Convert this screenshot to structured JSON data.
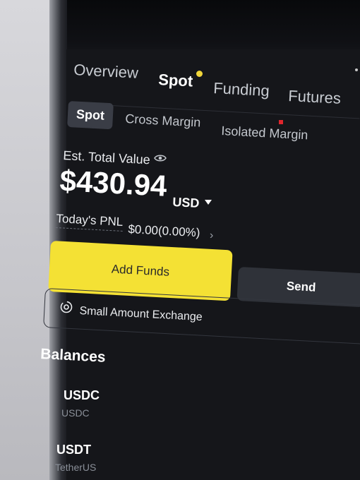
{
  "top_tabs": [
    {
      "label": "Overview"
    },
    {
      "label": "Spot"
    },
    {
      "label": "Funding"
    },
    {
      "label": "Futures"
    }
  ],
  "sub_tabs": [
    {
      "label": "Spot"
    },
    {
      "label": "Cross Margin"
    },
    {
      "label": "Isolated Margin"
    }
  ],
  "summary": {
    "est_label": "Est. Total Value",
    "total_value": "$430.94",
    "currency": "USD",
    "pnl_label": "Today's PNL",
    "pnl_value": "$0.00(0.00%)"
  },
  "actions": {
    "add_funds": "Add Funds",
    "send": "Send"
  },
  "small_exchange": {
    "label": "Small Amount Exchange"
  },
  "balances": {
    "title": "Balances",
    "items": [
      {
        "symbol": "USDC",
        "name": "USDC"
      },
      {
        "symbol": "USDT",
        "name": "TetherUS"
      }
    ]
  },
  "colors": {
    "accent": "#f4e134",
    "background": "#15161a",
    "notification_dot": "#f0d53a"
  }
}
